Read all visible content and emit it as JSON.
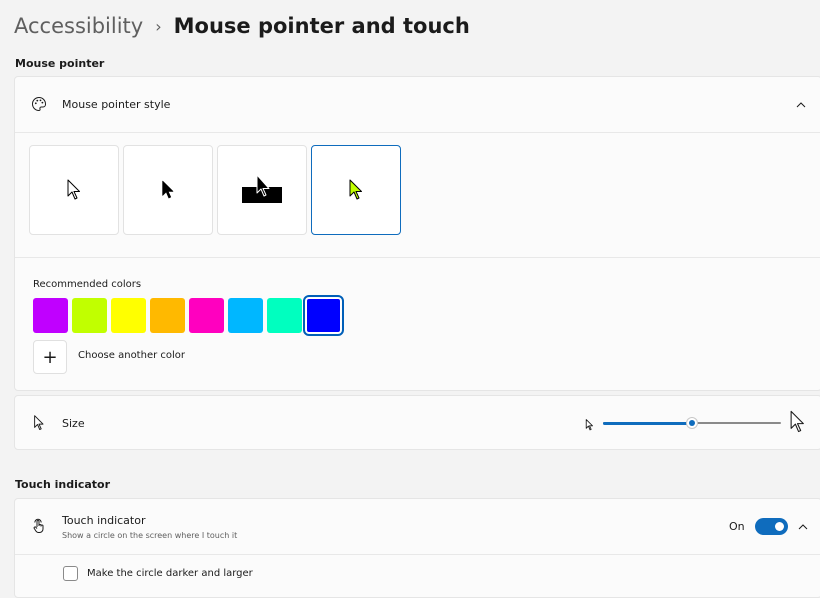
{
  "header": {
    "breadcrumb_parent": "Accessibility",
    "separator": "›",
    "page_title": "Mouse pointer and touch"
  },
  "mouse_pointer_section": {
    "label": "Mouse pointer",
    "style_row": {
      "icon": "palette-icon",
      "label": "Mouse pointer style",
      "expanded": true
    },
    "pointer_styles": [
      {
        "name": "white",
        "selected": false
      },
      {
        "name": "black",
        "selected": false
      },
      {
        "name": "inverted",
        "selected": false
      },
      {
        "name": "custom",
        "selected": true,
        "color": "#c1ff00"
      }
    ],
    "recommended_colors_label": "Recommended colors",
    "colors": [
      "#c000ff",
      "#c1ff00",
      "#ffff00",
      "#ffb900",
      "#ff00bf",
      "#00b7ff",
      "#00ffbf",
      "#0000ff"
    ],
    "selected_color_index": 7,
    "choose_color_label": "Choose another color",
    "size_row": {
      "icon": "pointer-icon",
      "label": "Size",
      "slider_value": 0.5
    }
  },
  "touch_section": {
    "label": "Touch indicator",
    "touch_row": {
      "icon": "touch-icon",
      "label": "Touch indicator",
      "description": "Show a circle on the screen where I touch it",
      "toggle_state": "On",
      "enabled": true
    },
    "darker_option": {
      "label": "Make the circle darker and larger",
      "checked": false
    }
  },
  "colors": {
    "accent": "#0f6cbd",
    "slider_track": "#8a8a8a"
  }
}
